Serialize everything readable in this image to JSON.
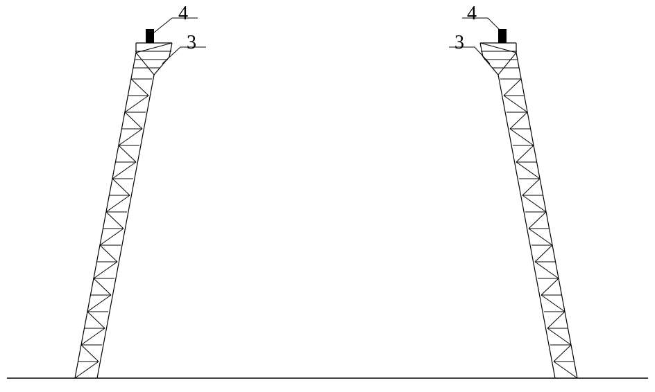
{
  "labels": {
    "left_top": "4",
    "left_upper": "3",
    "right_top": "4",
    "right_upper": "3"
  },
  "diagram": {
    "type": "technical-drawing",
    "description": "Two symmetric lattice tower structures leaning inward, with numbered callouts at top"
  }
}
